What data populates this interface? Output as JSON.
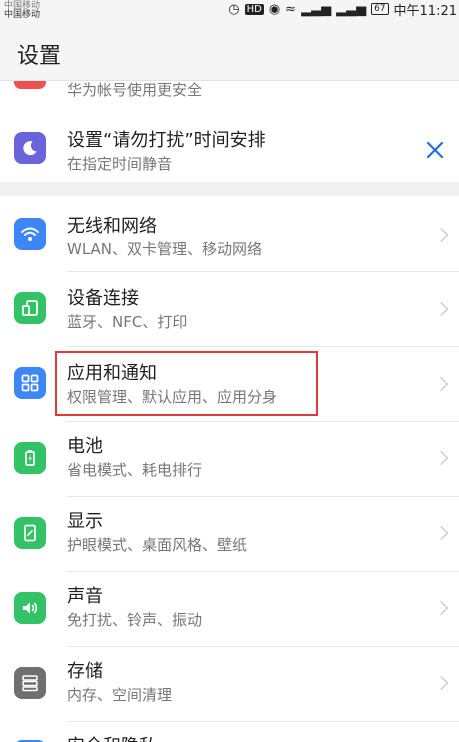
{
  "status_bar": {
    "carrier_top": "中国移动",
    "carrier": "中国移动",
    "battery": "67",
    "time": "中午11:21"
  },
  "header": {
    "title": "设置"
  },
  "partial_item": {
    "subtitle": "华为帐号使用更安全"
  },
  "dnd": {
    "title": "设置“请勿打扰”时间安排",
    "subtitle": "在指定时间静音"
  },
  "items": [
    {
      "title": "无线和网络",
      "subtitle": "WLAN、双卡管理、移动网络",
      "icon": "wifi-icon",
      "color": "#3d86f5"
    },
    {
      "title": "设备连接",
      "subtitle": "蓝牙、NFC、打印",
      "icon": "device-connection-icon",
      "color": "#34c267"
    },
    {
      "title": "应用和通知",
      "subtitle": "权限管理、默认应用、应用分身",
      "icon": "apps-icon",
      "color": "#3d86f5"
    },
    {
      "title": "电池",
      "subtitle": "省电模式、耗电排行",
      "icon": "battery-icon",
      "color": "#34c267"
    },
    {
      "title": "显示",
      "subtitle": "护眼模式、桌面风格、壁纸",
      "icon": "display-icon",
      "color": "#34c267"
    },
    {
      "title": "声音",
      "subtitle": "免打扰、铃声、振动",
      "icon": "sound-icon",
      "color": "#34c267"
    },
    {
      "title": "存储",
      "subtitle": "内存、空间清理",
      "icon": "storage-icon",
      "color": "#6f6f6f"
    },
    {
      "title": "安全和隐私",
      "subtitle": "",
      "icon": "security-icon",
      "color": "#3d86f5"
    }
  ],
  "colors": {
    "highlight": "#e0393e",
    "accent": "#1f6fd6"
  }
}
